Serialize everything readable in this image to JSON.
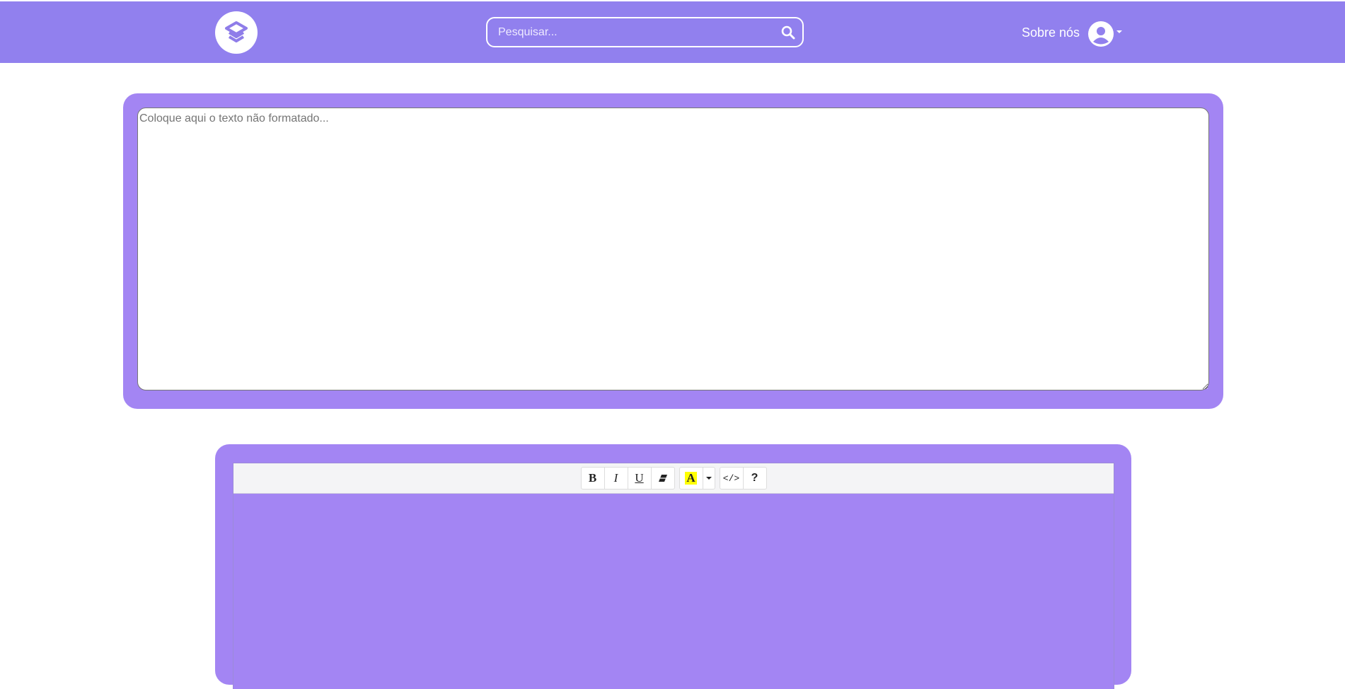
{
  "navbar": {
    "background": "#9180ee",
    "logo_icon": "layers-icon",
    "search": {
      "placeholder": "Pesquisar...",
      "value": "",
      "icon": "search-icon"
    },
    "about_label": "Sobre nós",
    "user_icon": "user-circle-icon",
    "user_caret_icon": "caret-down-icon"
  },
  "input_panel": {
    "background": "#a385f3",
    "textarea": {
      "placeholder": "Coloque aqui o texto não formatado...",
      "value": ""
    }
  },
  "editor_panel": {
    "background": "#a385f3",
    "toolbar": {
      "bold_label": "B",
      "italic_label": "I",
      "underline_label": "U",
      "eraser_icon": "eraser-icon",
      "highlight_label": "A",
      "highlight_color": "#ffff00",
      "dropdown_icon": "caret-down-icon",
      "code_label": "</>",
      "help_label": "?"
    },
    "content": ""
  }
}
